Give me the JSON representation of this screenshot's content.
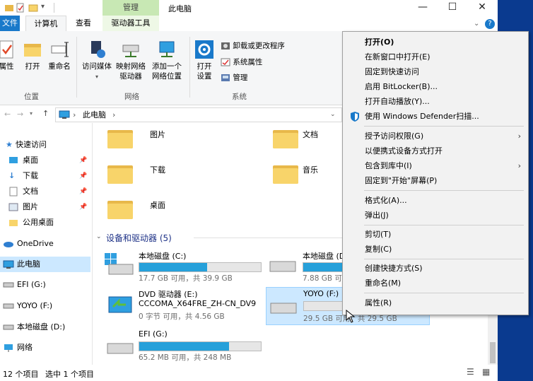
{
  "titlebar": {
    "manage_tab": "管理",
    "window_title": "此电脑",
    "minimize": "—",
    "maximize": "☐",
    "close": "✕"
  },
  "tabs": {
    "file": "文件",
    "computer": "计算机",
    "view": "查看",
    "drive_tools": "驱动器工具",
    "help": "?"
  },
  "ribbon": {
    "properties": "属性",
    "open": "打开",
    "rename": "重命名",
    "location_group": "位置",
    "access_media": "访问媒体",
    "map_drive_line1": "映射网络",
    "map_drive_line2": "驱动器",
    "add_location_line1": "添加一个",
    "add_location_line2": "网络位置",
    "network_group": "网络",
    "open_settings_line1": "打开",
    "open_settings_line2": "设置",
    "uninstall": "卸载或更改程序",
    "system_props": "系统属性",
    "manage": "管理",
    "system_group": "系统"
  },
  "address": {
    "path": "此电脑",
    "chevron": "›"
  },
  "nav": {
    "quick_access": "快速访问",
    "desktop": "桌面",
    "downloads": "下载",
    "documents": "文档",
    "pictures": "图片",
    "public_desktop": "公用桌面",
    "onedrive": "OneDrive",
    "this_pc": "此电脑",
    "efi": "EFI (G:)",
    "yoyo": "YOYO (F:)",
    "local_d": "本地磁盘 (D:)",
    "network": "网络"
  },
  "folders": {
    "pictures": "图片",
    "documents": "文档",
    "downloads": "下载",
    "music": "音乐",
    "desktop": "桌面"
  },
  "devices_header": "设备和驱动器 (5)",
  "drives": [
    {
      "name": "本地磁盘 (C:)",
      "info": "17.7 GB 可用，共 39.9 GB",
      "used_fraction": 0.56
    },
    {
      "name": "本地磁盘 (D:)",
      "info": "7.88 GB 可用",
      "used_fraction": 0.7
    },
    {
      "name": "DVD 驱动器 (E:)",
      "label": "CCCOMA_X64FRE_ZH-CN_DV9",
      "info": "0 字节 可用，共 4.56 GB"
    },
    {
      "name": "YOYO (F:)",
      "info": "29.5 GB 可用，共 29.5 GB",
      "used_fraction": 0.0
    },
    {
      "name": "EFI (G:)",
      "info": "65.2 MB 可用，共 248 MB",
      "used_fraction": 0.74
    }
  ],
  "status": {
    "items": "12 个项目",
    "selected": "选中 1 个项目"
  },
  "context_menu": {
    "open": "打开(O)",
    "open_new_window": "在新窗口中打开(E)",
    "pin_quick": "固定到快速访问",
    "bitlocker": "启用 BitLocker(B)...",
    "autoplay": "打开自动播放(Y)...",
    "defender": "使用 Windows Defender扫描...",
    "give_access": "授予访问权限(G)",
    "portable": "以便携式设备方式打开",
    "include_library": "包含到库中(I)",
    "pin_start": "固定到\"开始\"屏幕(P)",
    "format": "格式化(A)...",
    "eject": "弹出(J)",
    "cut": "剪切(T)",
    "copy": "复制(C)",
    "shortcut": "创建快捷方式(S)",
    "rename": "重命名(M)",
    "properties": "属性(R)",
    "submenu_arrow": "›"
  },
  "colors": {
    "accent": "#26a0da",
    "manage_tab": "#c8e8b4",
    "desktop_blue": "#0a3a8f"
  }
}
